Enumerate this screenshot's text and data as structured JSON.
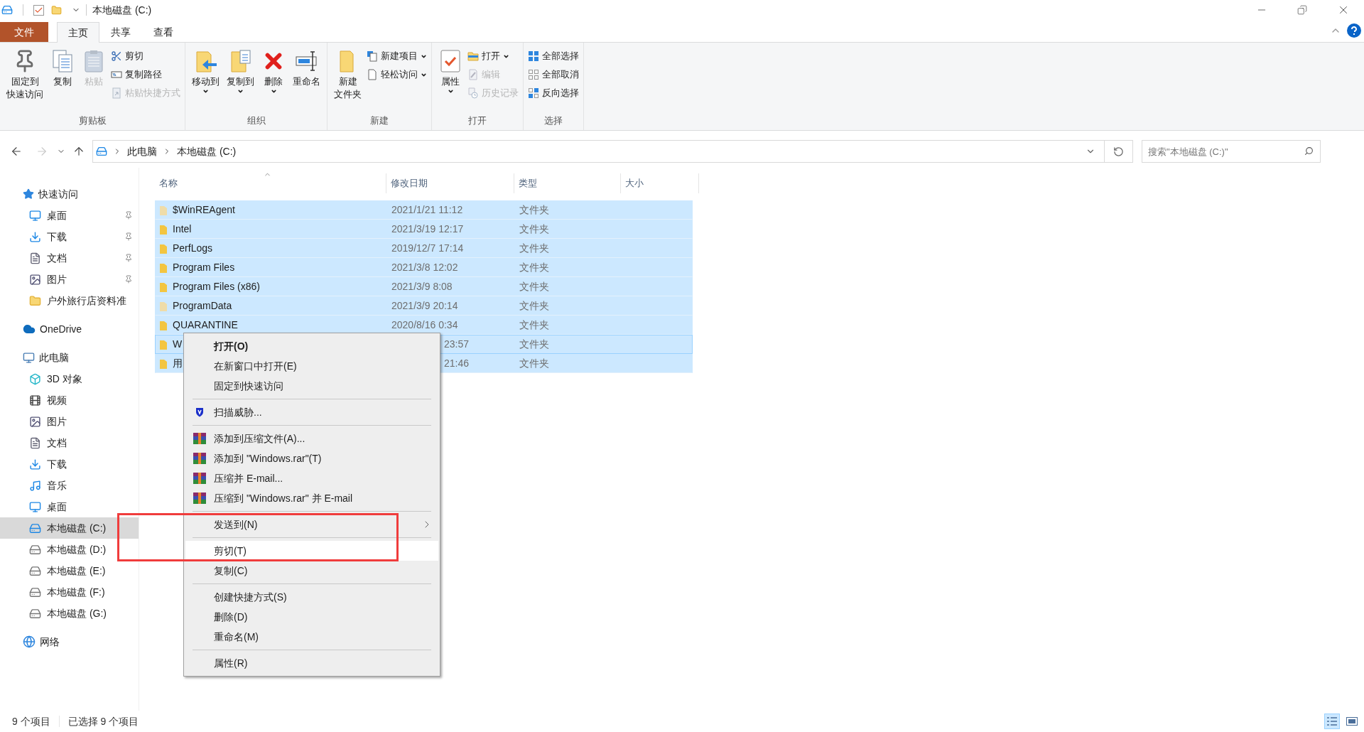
{
  "title_bar": {
    "title": "本地磁盘 (C:)"
  },
  "ribbon_tabs": [
    {
      "label": "文件",
      "kind": "file",
      "selected": false
    },
    {
      "label": "主页",
      "kind": "tab",
      "selected": true
    },
    {
      "label": "共享",
      "kind": "tab",
      "selected": false
    },
    {
      "label": "查看",
      "kind": "tab",
      "selected": false
    }
  ],
  "ribbon_groups": [
    {
      "label": "剪贴板",
      "large_buttons": [
        {
          "lines": [
            "固定到",
            "快速访问"
          ],
          "disabled": false,
          "dropdown": false
        },
        {
          "lines": [
            "复制"
          ],
          "disabled": false,
          "dropdown": false
        },
        {
          "lines": [
            "粘贴"
          ],
          "disabled": true,
          "dropdown": false
        }
      ],
      "small_buttons": [
        {
          "label": "剪切",
          "disabled": false,
          "dropdown": false
        },
        {
          "label": "复制路径",
          "disabled": false,
          "dropdown": false
        },
        {
          "label": "粘贴快捷方式",
          "disabled": true,
          "dropdown": false
        }
      ]
    },
    {
      "label": "组织",
      "large_buttons": [
        {
          "lines": [
            "移动到"
          ],
          "disabled": false,
          "dropdown": true
        },
        {
          "lines": [
            "复制到"
          ],
          "disabled": false,
          "dropdown": true
        },
        {
          "lines": [
            "删除"
          ],
          "disabled": false,
          "dropdown": true
        },
        {
          "lines": [
            "重命名"
          ],
          "disabled": false,
          "dropdown": false
        }
      ]
    },
    {
      "label": "新建",
      "large_buttons": [
        {
          "lines": [
            "新建",
            "文件夹"
          ],
          "disabled": false,
          "dropdown": false
        }
      ],
      "small_buttons": [
        {
          "label": "新建项目",
          "disabled": false,
          "dropdown": true
        },
        {
          "label": "轻松访问",
          "disabled": false,
          "dropdown": true
        }
      ]
    },
    {
      "label": "打开",
      "large_buttons": [
        {
          "lines": [
            "属性"
          ],
          "disabled": false,
          "dropdown": true
        }
      ],
      "small_buttons": [
        {
          "label": "打开",
          "disabled": false,
          "dropdown": true
        },
        {
          "label": "编辑",
          "disabled": true,
          "dropdown": false
        },
        {
          "label": "历史记录",
          "disabled": true,
          "dropdown": false
        }
      ]
    },
    {
      "label": "选择",
      "small_buttons": [
        {
          "label": "全部选择",
          "disabled": false,
          "dropdown": false
        },
        {
          "label": "全部取消",
          "disabled": false,
          "dropdown": false
        },
        {
          "label": "反向选择",
          "disabled": false,
          "dropdown": false
        }
      ]
    }
  ],
  "address_bar": {
    "breadcrumb": [
      "此电脑",
      "本地磁盘 (C:)"
    ],
    "forward_disabled": true
  },
  "search": {
    "placeholder": "搜索\"本地磁盘 (C:)\""
  },
  "sidebar": [
    {
      "label": "快速访问",
      "selected": false,
      "children": [
        {
          "label": "桌面",
          "pinned": true,
          "selected": false
        },
        {
          "label": "下载",
          "pinned": true,
          "selected": false
        },
        {
          "label": "文档",
          "pinned": true,
          "selected": false
        },
        {
          "label": "图片",
          "pinned": true,
          "selected": false
        },
        {
          "label": "户外旅行店资料准",
          "pinned": false,
          "selected": false
        }
      ]
    },
    {
      "label": "OneDrive",
      "selected": false
    },
    {
      "label": "此电脑",
      "selected": false,
      "children": [
        {
          "label": "3D 对象",
          "pinned": false,
          "selected": false
        },
        {
          "label": "视频",
          "pinned": false,
          "selected": false
        },
        {
          "label": "图片",
          "pinned": false,
          "selected": false
        },
        {
          "label": "文档",
          "pinned": false,
          "selected": false
        },
        {
          "label": "下载",
          "pinned": false,
          "selected": false
        },
        {
          "label": "音乐",
          "pinned": false,
          "selected": false
        },
        {
          "label": "桌面",
          "pinned": false,
          "selected": false
        },
        {
          "label": "本地磁盘 (C:)",
          "pinned": false,
          "selected": true
        },
        {
          "label": "本地磁盘 (D:)",
          "pinned": false,
          "selected": false
        },
        {
          "label": "本地磁盘 (E:)",
          "pinned": false,
          "selected": false
        },
        {
          "label": "本地磁盘 (F:)",
          "pinned": false,
          "selected": false
        },
        {
          "label": "本地磁盘 (G:)",
          "pinned": false,
          "selected": false
        }
      ]
    },
    {
      "label": "网络",
      "selected": false
    }
  ],
  "file_list": {
    "columns": [
      "名称",
      "修改日期",
      "类型",
      "大小"
    ],
    "rows": [
      {
        "name": "$WinREAgent",
        "date": "2021/1/21 11:12",
        "type": "文件夹",
        "selected": true,
        "focused": false,
        "covered": false,
        "pale": true
      },
      {
        "name": "Intel",
        "date": "2021/3/19 12:17",
        "type": "文件夹",
        "selected": true,
        "focused": false,
        "covered": false,
        "pale": false
      },
      {
        "name": "PerfLogs",
        "date": "2019/12/7 17:14",
        "type": "文件夹",
        "selected": true,
        "focused": false,
        "covered": false,
        "pale": false
      },
      {
        "name": "Program Files",
        "date": "2021/3/8 12:02",
        "type": "文件夹",
        "selected": true,
        "focused": false,
        "covered": false,
        "pale": false
      },
      {
        "name": "Program Files (x86)",
        "date": "2021/3/9 8:08",
        "type": "文件夹",
        "selected": true,
        "focused": false,
        "covered": false,
        "pale": false
      },
      {
        "name": "ProgramData",
        "date": "2021/3/9 20:14",
        "type": "文件夹",
        "selected": true,
        "focused": false,
        "covered": false,
        "pale": true
      },
      {
        "name": "QUARANTINE",
        "date": "2020/8/16 0:34",
        "type": "文件夹",
        "selected": true,
        "focused": false,
        "covered": false,
        "pale": false
      },
      {
        "name": "W",
        "date": "23:57",
        "type": "文件夹",
        "selected": true,
        "focused": true,
        "covered": true,
        "pale": false
      },
      {
        "name": "用",
        "date": "21:46",
        "type": "文件夹",
        "selected": true,
        "focused": false,
        "covered": true,
        "pale": false
      }
    ]
  },
  "context_menu": [
    {
      "kind": "plain",
      "label": "打开(O)",
      "bold": true,
      "submenu": false,
      "highlighted": false
    },
    {
      "kind": "plain",
      "label": "在新窗口中打开(E)",
      "bold": false,
      "submenu": false,
      "highlighted": false
    },
    {
      "kind": "plain",
      "label": "固定到快速访问",
      "bold": false,
      "submenu": false,
      "highlighted": false
    },
    {
      "kind": "separator"
    },
    {
      "kind": "shield",
      "label": "扫描威胁...",
      "bold": false,
      "submenu": false,
      "highlighted": false
    },
    {
      "kind": "separator"
    },
    {
      "kind": "archive",
      "label": "添加到压缩文件(A)...",
      "bold": false,
      "submenu": false,
      "highlighted": false
    },
    {
      "kind": "archive",
      "label": "添加到 \"Windows.rar\"(T)",
      "bold": false,
      "submenu": false,
      "highlighted": false
    },
    {
      "kind": "archive",
      "label": "压缩并 E-mail...",
      "bold": false,
      "submenu": false,
      "highlighted": false
    },
    {
      "kind": "archive",
      "label": "压缩到 \"Windows.rar\" 并 E-mail",
      "bold": false,
      "submenu": false,
      "highlighted": false
    },
    {
      "kind": "separator"
    },
    {
      "kind": "plain",
      "label": "发送到(N)",
      "bold": false,
      "submenu": true,
      "highlighted": false
    },
    {
      "kind": "separator"
    },
    {
      "kind": "plain",
      "label": "剪切(T)",
      "bold": false,
      "submenu": false,
      "highlighted": true
    },
    {
      "kind": "plain",
      "label": "复制(C)",
      "bold": false,
      "submenu": false,
      "highlighted": false
    },
    {
      "kind": "separator"
    },
    {
      "kind": "plain",
      "label": "创建快捷方式(S)",
      "bold": false,
      "submenu": false,
      "highlighted": false
    },
    {
      "kind": "plain",
      "label": "删除(D)",
      "bold": false,
      "submenu": false,
      "highlighted": false
    },
    {
      "kind": "plain",
      "label": "重命名(M)",
      "bold": false,
      "submenu": false,
      "highlighted": false
    },
    {
      "kind": "separator"
    },
    {
      "kind": "plain",
      "label": "属性(R)",
      "bold": false,
      "submenu": false,
      "highlighted": false
    }
  ],
  "status_bar": {
    "item_count": "9 个项目",
    "selection": "已选择 9 个项目",
    "views": [
      {
        "kind": "details",
        "selected": true
      },
      {
        "kind": "large",
        "selected": false
      }
    ]
  }
}
